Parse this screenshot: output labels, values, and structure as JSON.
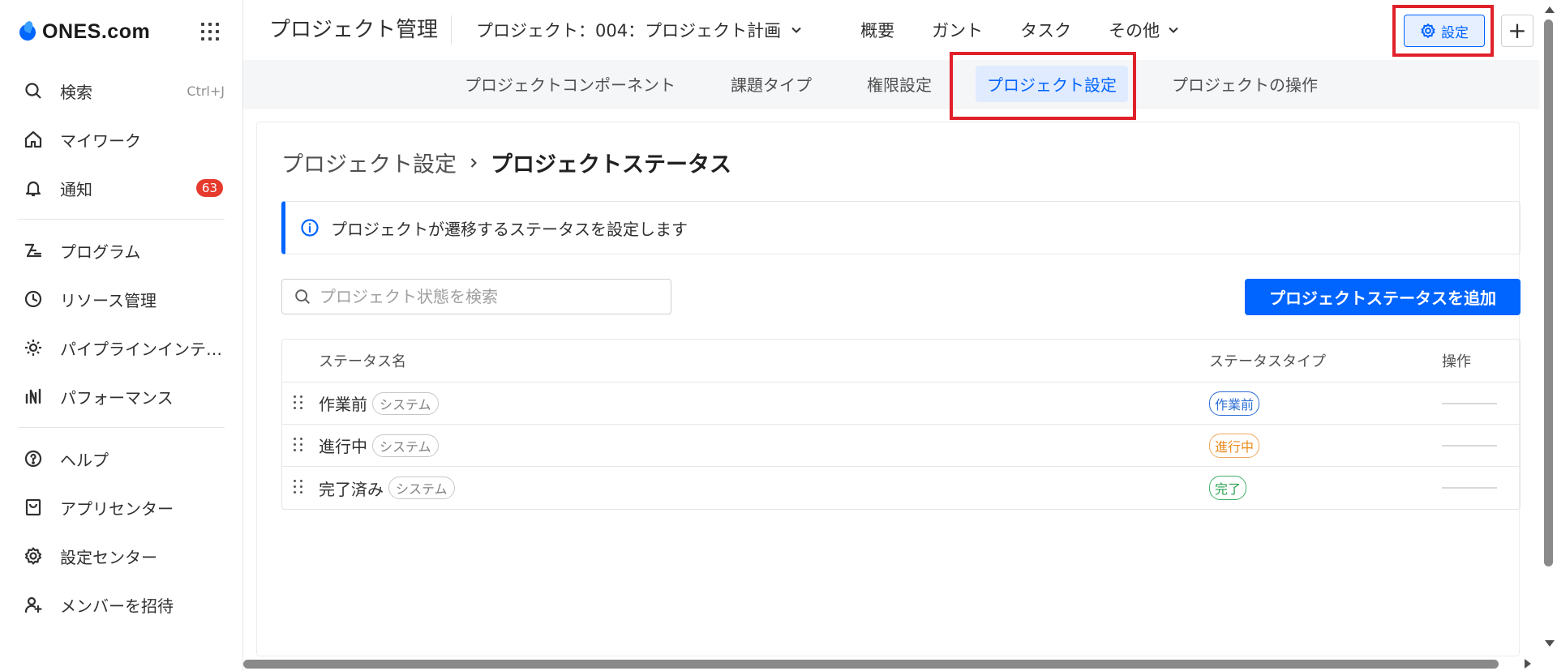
{
  "brand": {
    "name": "ONES.com"
  },
  "sidebar": {
    "search": {
      "label": "検索",
      "shortcut": "Ctrl+J"
    },
    "items": [
      {
        "label": "マイワーク",
        "icon": "home-icon"
      },
      {
        "label": "通知",
        "icon": "bell-icon",
        "badge": "63"
      },
      {
        "label": "プログラム",
        "icon": "program-icon"
      },
      {
        "label": "リソース管理",
        "icon": "clock-icon"
      },
      {
        "label": "パイプラインインテ…",
        "icon": "pipeline-icon"
      },
      {
        "label": "パフォーマンス",
        "icon": "chart-icon"
      },
      {
        "label": "ヘルプ",
        "icon": "help-icon"
      },
      {
        "label": "アプリセンター",
        "icon": "app-store-icon"
      },
      {
        "label": "設定センター",
        "icon": "gear-icon"
      },
      {
        "label": "メンバーを招待",
        "icon": "invite-user-icon"
      }
    ]
  },
  "header": {
    "app_title": "プロジェクト管理",
    "project": "プロジェクト：004：プロジェクト計画",
    "tabs": [
      "概要",
      "ガント",
      "タスク",
      "その他"
    ],
    "settings_label": "設定",
    "plus_label": "+"
  },
  "subnav": {
    "tabs": [
      "プロジェクトコンポーネント",
      "課題タイプ",
      "権限設定",
      "プロジェクト設定",
      "プロジェクトの操作"
    ],
    "active_index": 3
  },
  "main": {
    "breadcrumb_parent": "プロジェクト設定",
    "breadcrumb_current": "プロジェクトステータス",
    "info_text": "プロジェクトが遷移するステータスを設定します",
    "search_placeholder": "プロジェクト状態を検索",
    "add_button": "プロジェクトステータスを追加",
    "table": {
      "columns": [
        "ステータス名",
        "ステータスタイプ",
        "操作"
      ],
      "rows": [
        {
          "name": "作業前",
          "tag": "システム",
          "type": "作業前",
          "type_color": "#2d6fd6"
        },
        {
          "name": "進行中",
          "tag": "システム",
          "type": "進行中",
          "type_color": "#e88a1a"
        },
        {
          "name": "完了済み",
          "tag": "システム",
          "type": "完了",
          "type_color": "#27a050"
        }
      ]
    }
  },
  "colors": {
    "accent": "#0064ff",
    "highlight": "#e0202a",
    "badge": "#e63a2e"
  }
}
